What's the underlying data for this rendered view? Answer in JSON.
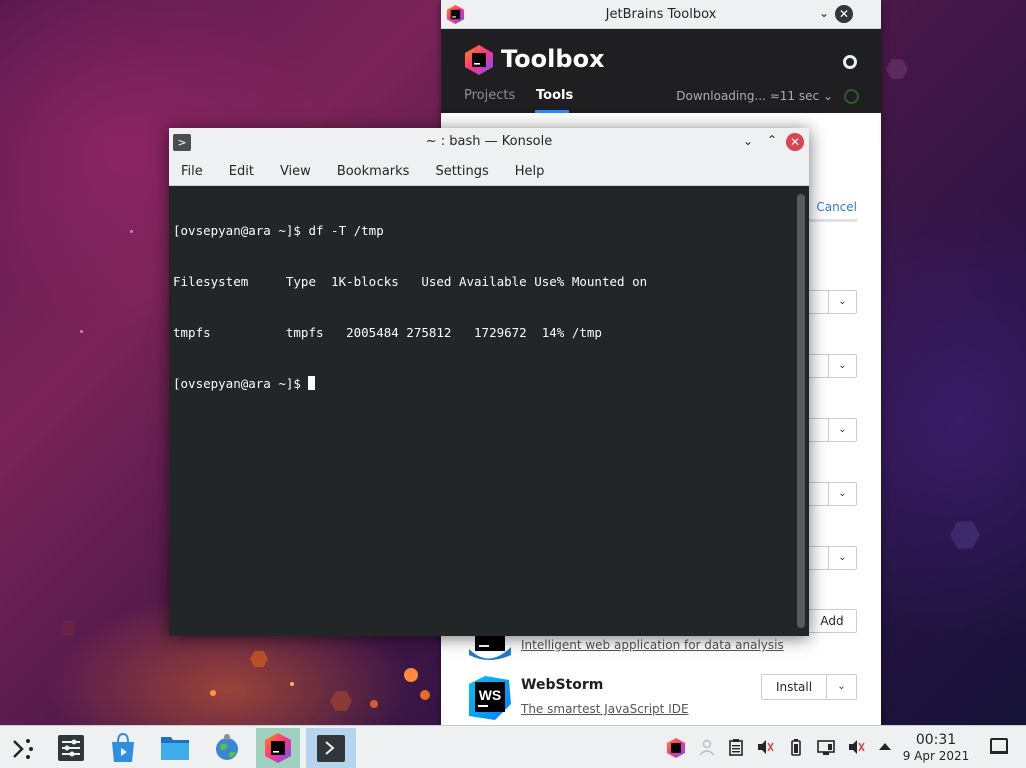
{
  "toolbox": {
    "window_title": "JetBrains Toolbox",
    "brand": "Toolbox",
    "tabs": [
      "Projects",
      "Tools"
    ],
    "active_tab": "Tools",
    "download_status": "Downloading... ≈11 sec",
    "download_chevron": "⌄",
    "cancel_label": "Cancel",
    "add_label": "Add",
    "datalore_desc": "Intelligent web application for data analysis",
    "webstorm": {
      "name": "WebStorm",
      "desc": "The smartest JavaScript IDE",
      "install_label": "Install",
      "icon_text": "WS"
    },
    "minimize_glyph": "⌄",
    "close_glyph": "✕",
    "dropdown_chevron": "⌄",
    "accent_color": "#1e90ff"
  },
  "konsole": {
    "window_title": "~ : bash — Konsole",
    "app_icon_glyph": ">",
    "menu": [
      "File",
      "Edit",
      "View",
      "Bookmarks",
      "Settings",
      "Help"
    ],
    "terminal_lines": [
      "[ovsepyan@ara ~]$ df -T /tmp",
      "Filesystem     Type  1K-blocks   Used Available Use% Mounted on",
      "tmpfs          tmpfs   2005484 275812   1729672  14% /tmp"
    ],
    "prompt": "[ovsepyan@ara ~]$ ",
    "minimize_glyph": "⌄",
    "maximize_glyph": "⌃",
    "close_glyph": "✕"
  },
  "taskbar": {
    "launchers": [
      "application-launcher-icon",
      "system-settings-icon",
      "discover-store-icon",
      "dolphin-files-icon",
      "web-browser-icon",
      "jetbrains-toolbox-task-icon",
      "konsole-task-icon"
    ],
    "tray_icons": [
      "jetbrains-toolbox-tray-icon",
      "user-icon",
      "clipboard-icon",
      "audio-muted-icon",
      "battery-icon",
      "network-icon",
      "volume-muted-icon",
      "tray-expand-icon"
    ],
    "clock_time": "00:31",
    "clock_date": "9 Apr 2021"
  }
}
